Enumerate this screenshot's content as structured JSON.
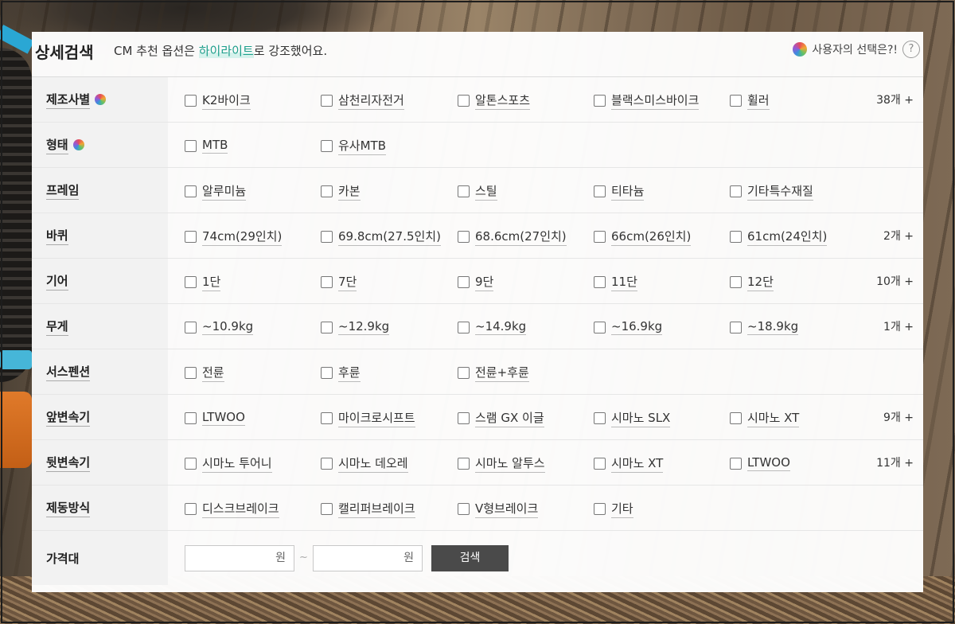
{
  "header": {
    "title": "상세검색",
    "desc_pre": "CM 추천 옵션은 ",
    "desc_highlight": "하이라이트",
    "desc_post": "로 강조했어요.",
    "user_pick": "사용자의 선택은?!",
    "help": "?"
  },
  "rows": [
    {
      "label": "제조사별",
      "orb": true,
      "options": [
        "K2바이크",
        "삼천리자전거",
        "알톤스포츠",
        "블랙스미스바이크",
        "휠러"
      ],
      "more": "38개 +"
    },
    {
      "label": "형태",
      "orb": true,
      "options": [
        "MTB",
        "유사MTB"
      ],
      "more": ""
    },
    {
      "label": "프레임",
      "orb": false,
      "options": [
        "알루미늄",
        "카본",
        "스틸",
        "티타늄",
        "기타특수재질"
      ],
      "more": ""
    },
    {
      "label": "바퀴",
      "orb": false,
      "options": [
        "74cm(29인치)",
        "69.8cm(27.5인치)",
        "68.6cm(27인치)",
        "66cm(26인치)",
        "61cm(24인치)"
      ],
      "more": "2개 +"
    },
    {
      "label": "기어",
      "orb": false,
      "options": [
        "1단",
        "7단",
        "9단",
        "11단",
        "12단"
      ],
      "more": "10개 +"
    },
    {
      "label": "무게",
      "orb": false,
      "options": [
        "~10.9kg",
        "~12.9kg",
        "~14.9kg",
        "~16.9kg",
        "~18.9kg"
      ],
      "more": "1개 +"
    },
    {
      "label": "서스펜션",
      "orb": false,
      "options": [
        "전륜",
        "후륜",
        "전륜+후륜"
      ],
      "more": ""
    },
    {
      "label": "앞변속기",
      "orb": false,
      "options": [
        "LTWOO",
        "마이크로시프트",
        "스램 GX 이글",
        "시마노 SLX",
        "시마노 XT"
      ],
      "more": "9개 +"
    },
    {
      "label": "뒷변속기",
      "orb": false,
      "options": [
        "시마노 투어니",
        "시마노 데오레",
        "시마노 알투스",
        "시마노 XT",
        "LTWOO"
      ],
      "more": "11개 +"
    },
    {
      "label": "제동방식",
      "orb": false,
      "options": [
        "디스크브레이크",
        "캘리퍼브레이크",
        "V형브레이크",
        "기타"
      ],
      "more": ""
    }
  ],
  "price": {
    "label": "가격대",
    "min_unit": "원",
    "max_unit": "원",
    "separator": "~",
    "search_label": "검색"
  }
}
